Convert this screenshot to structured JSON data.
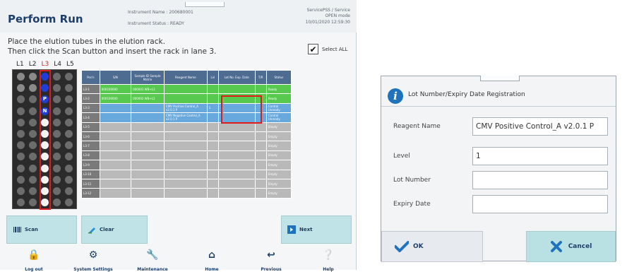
{
  "main": {
    "title": "Perform Run",
    "instrument_name": "Instrument Name : 200680001",
    "instrument_status": "Instrument Status : READY",
    "user": "ServicePSS / Service",
    "mode": "OPEN mode",
    "datetime": "10/01/2020 12:59:30",
    "instruction_line1": "Place the elution tubes in the elution rack.",
    "instruction_line2": "Then click the Scan button and insert the rack in lane 3.",
    "select_all_label": "Select ALL",
    "select_all_checked": true,
    "lanes": [
      "L1",
      "L2",
      "L3",
      "L4",
      "L5"
    ],
    "selected_lane": "L3",
    "rack_letters": [
      "P",
      "N"
    ],
    "table": {
      "headers": [
        "Pos'n",
        "S/N",
        "Sample ID Sample Matrix",
        "Reagent Name",
        "Lvl",
        "Lot No. Exp. Date",
        "T/R",
        "Status"
      ],
      "rows": [
        {
          "pos": "L3-1",
          "sn": "000100000",
          "sample": "000001 WB+L1",
          "reagent": "",
          "lvl": "",
          "lot": "",
          "tr": "",
          "status": "Ready",
          "color": "green"
        },
        {
          "pos": "L3-2",
          "sn": "000100000",
          "sample": "000002 WB+L2",
          "reagent": "",
          "lvl": "",
          "lot": "",
          "tr": "",
          "status": "Ready",
          "color": "green"
        },
        {
          "pos": "L3-3",
          "sn": "",
          "sample": "",
          "reagent": "CMV Positive Control_A v2.0.1 P",
          "lvl": "1",
          "lot": "",
          "tr": "",
          "status": "Control Unready",
          "color": "blue"
        },
        {
          "pos": "L3-4",
          "sn": "",
          "sample": "",
          "reagent": "CMV Negative Control_A v2.0.1 P",
          "lvl": "",
          "lot": "",
          "tr": "",
          "status": "Control Unready",
          "color": "blue"
        },
        {
          "pos": "L3-5",
          "sn": "",
          "sample": "",
          "reagent": "",
          "lvl": "",
          "lot": "",
          "tr": "",
          "status": "Empty",
          "color": "gray"
        },
        {
          "pos": "L3-6",
          "sn": "",
          "sample": "",
          "reagent": "",
          "lvl": "",
          "lot": "",
          "tr": "",
          "status": "Empty",
          "color": "gray"
        },
        {
          "pos": "L3-7",
          "sn": "",
          "sample": "",
          "reagent": "",
          "lvl": "",
          "lot": "",
          "tr": "",
          "status": "Empty",
          "color": "gray"
        },
        {
          "pos": "L3-8",
          "sn": "",
          "sample": "",
          "reagent": "",
          "lvl": "",
          "lot": "",
          "tr": "",
          "status": "Empty",
          "color": "gray"
        },
        {
          "pos": "L3-9",
          "sn": "",
          "sample": "",
          "reagent": "",
          "lvl": "",
          "lot": "",
          "tr": "",
          "status": "Empty",
          "color": "gray"
        },
        {
          "pos": "L3-10",
          "sn": "",
          "sample": "",
          "reagent": "",
          "lvl": "",
          "lot": "",
          "tr": "",
          "status": "Empty",
          "color": "gray"
        },
        {
          "pos": "L3-11",
          "sn": "",
          "sample": "",
          "reagent": "",
          "lvl": "",
          "lot": "",
          "tr": "",
          "status": "Empty",
          "color": "gray"
        },
        {
          "pos": "L3-12",
          "sn": "",
          "sample": "",
          "reagent": "",
          "lvl": "",
          "lot": "",
          "tr": "",
          "status": "Empty",
          "color": "gray"
        }
      ]
    },
    "buttons": {
      "scan": "Scan",
      "clear": "Clear",
      "next": "Next"
    },
    "nav": [
      {
        "label": "Log out",
        "icon": "lock-icon"
      },
      {
        "label": "System Settings",
        "icon": "gear-icon"
      },
      {
        "label": "Maintenance",
        "icon": "wrench-icon"
      },
      {
        "label": "Home",
        "icon": "home-icon"
      },
      {
        "label": "Previous",
        "icon": "previous-icon"
      },
      {
        "label": "Help",
        "icon": "help-icon"
      }
    ]
  },
  "dialog": {
    "title": "Lot Number/Expiry Date Registration",
    "fields": [
      {
        "label": "Reagent Name",
        "value": "CMV Positive Control_A v2.0.1 P"
      },
      {
        "label": "Level",
        "value": "1"
      },
      {
        "label": "Lot Number",
        "value": ""
      },
      {
        "label": "Expiry Date",
        "value": ""
      }
    ],
    "ok_label": "OK",
    "cancel_label": "Cancel"
  },
  "colors": {
    "accent": "#1d3f6a",
    "header_blue": "#4e6b91",
    "row_green": "#57c94f",
    "row_blue": "#67a9dd",
    "row_gray": "#b9b9b9",
    "highlight_red": "#e01b1b",
    "button_teal": "#bfe3e6",
    "info_blue": "#1f73bd"
  }
}
